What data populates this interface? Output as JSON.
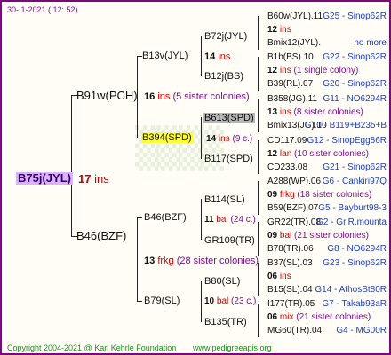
{
  "header": {
    "date": "30- 1-2021 ( 12: 52)"
  },
  "root": {
    "id": "B75j(JYL)",
    "num": "17",
    "unit": "ins"
  },
  "g1": [
    {
      "id": "B91w(PCH)",
      "num": "16",
      "unit": "ins",
      "note": "(5 sister colonies)"
    },
    {
      "id": "B46(BZF)",
      "num": "13",
      "unit": "frkg",
      "note": "(28 sister colonies)"
    }
  ],
  "g2": [
    {
      "id": "B13v(JYL)"
    },
    {
      "id": "B394(SPD)",
      "num": "14",
      "unit": "ins",
      "note": "(9 c.)"
    },
    {
      "id": "B46(BZF)"
    },
    {
      "id": "B79(SL)"
    }
  ],
  "g3": [
    {
      "id": "B72j(JYL)",
      "num": "14",
      "unit": "ins"
    },
    {
      "id": "B12j(BS)"
    },
    {
      "id": "B613(SPD)"
    },
    {
      "id": "B117(SPD)"
    },
    {
      "id": "B114(SL)",
      "num": "11",
      "unit": "bal",
      "note": "(24 c.)"
    },
    {
      "id": "GR109(TR)"
    },
    {
      "id": "B80(SL)",
      "num": "10",
      "unit": "bal",
      "note": "(23 c.)"
    },
    {
      "id": "B135(TR)"
    }
  ],
  "g4": [
    {
      "top": {
        "id": "B60w(JYL).11",
        "g": "G25 - Sinop62R"
      },
      "mid": {
        "num": "12",
        "unit": "ins",
        "note": ""
      },
      "bot": {
        "id": "Bmix12(JYL).",
        "g": "no more"
      }
    },
    {
      "top": {
        "id": "B1b(BS).10",
        "g": "G22 - Sinop62R"
      },
      "mid": {
        "num": "12",
        "unit": "ins",
        "note": "(1 single colony)"
      },
      "bot": {
        "id": "B39(RL).07",
        "g": "G20 - Sinop62R"
      }
    },
    {
      "top": {
        "id": "B358(JG).11",
        "g": "G11 - NO6294R"
      },
      "mid": {
        "num": "13",
        "unit": "ins",
        "note": "(8 sister colonies)"
      },
      "bot": {
        "id": "Bmix13(JG).10",
        "g": "G10 - B119+B235+B"
      }
    },
    {
      "top": {
        "id": "CD117.09",
        "g": "G12 - SinopEgg86R"
      },
      "mid": {
        "num": "12",
        "unit": "lan",
        "note": "(10 sister colonies)"
      },
      "bot": {
        "id": "CD233.08",
        "g": "G21 - Sinop62R"
      }
    },
    {
      "top": {
        "id": "A288(WP).06",
        "g": "G6 - Cankiri97Q"
      },
      "mid": {
        "num": "09",
        "unit": "frkg",
        "note": "(18 sister colonies)"
      },
      "bot": {
        "id": "B59(BZF).07",
        "g": "G5 - Bayburt98-3"
      }
    },
    {
      "top": {
        "id": "GR22(TR).08",
        "g": "G2 - Gr.R.mounta"
      },
      "mid": {
        "num": "09",
        "unit": "bal",
        "note": "(21 sister colonies)"
      },
      "bot": {
        "id": "B78(TR).06",
        "g": "G8 - NO6294R"
      }
    },
    {
      "top": {
        "id": "B37(SL).03",
        "g": "G23 - Sinop62R"
      },
      "mid": {
        "num": "06",
        "unit": "ins",
        "note": ""
      },
      "bot": {
        "id": "B15(SL).04",
        "g": "G14 - AthosSt80R"
      }
    },
    {
      "top": {
        "id": "I177(TR).05",
        "g": "G7 - Takab93aR"
      },
      "mid": {
        "num": "06",
        "unit": "mix",
        "note": "(21 sister colonies)"
      },
      "bot": {
        "id": "MG60(TR).04",
        "g": "G4 - MG00R"
      }
    }
  ],
  "footer": {
    "copyright": "Copyright 2004-2021 @ Karl Kehrle Foundation",
    "url": "www.pedigreeapis.org"
  }
}
